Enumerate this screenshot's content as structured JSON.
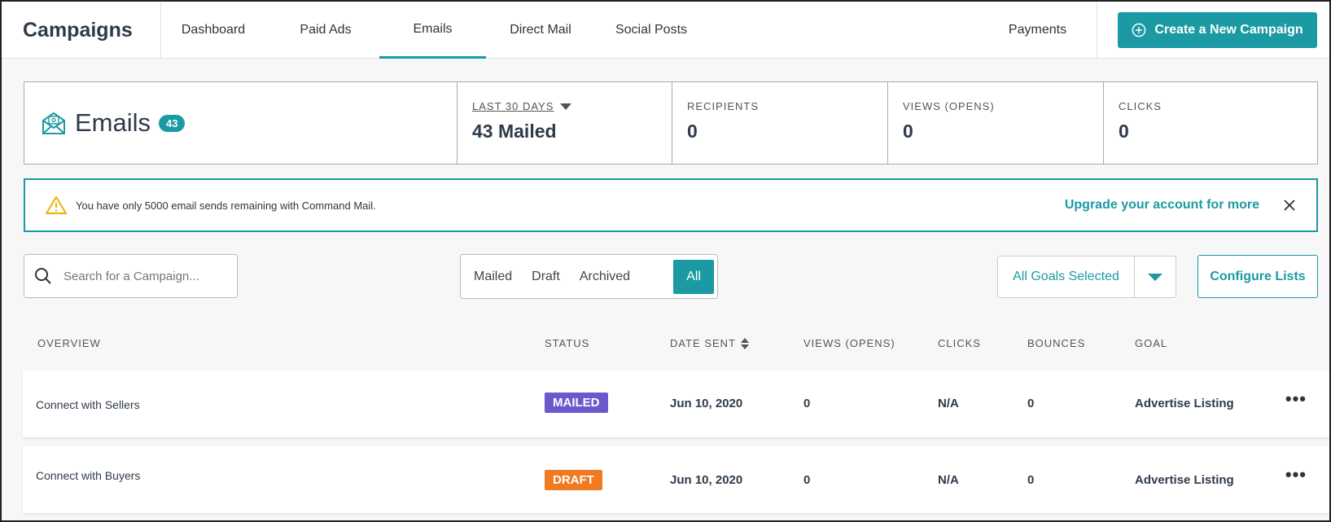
{
  "app": {
    "title": "Campaigns"
  },
  "nav": {
    "tabs": [
      {
        "label": "Dashboard"
      },
      {
        "label": "Paid Ads"
      },
      {
        "label": "Emails"
      },
      {
        "label": "Direct Mail"
      },
      {
        "label": "Social Posts"
      }
    ],
    "active_tab": "Emails",
    "payments": "Payments",
    "create_button": "Create a New Campaign"
  },
  "stats": {
    "title": "Emails",
    "badge": "43",
    "period_label": "LAST 30 DAYS",
    "mailed": "43 Mailed",
    "recipients_label": "RECIPIENTS",
    "recipients_value": "0",
    "views_label": "VIEWS (OPENS)",
    "views_value": "0",
    "clicks_label": "CLICKS",
    "clicks_value": "0"
  },
  "alert": {
    "message": "You have only 5000 email sends remaining with Command Mail.",
    "link": "Upgrade your account for more"
  },
  "filters": {
    "search_placeholder": "Search for a Campaign...",
    "segments": [
      "Mailed",
      "Draft",
      "Archived",
      "All"
    ],
    "active_segment": "All",
    "goals_label": "All Goals Selected",
    "configure_label": "Configure Lists"
  },
  "table": {
    "headers": {
      "overview": "OVERVIEW",
      "status": "STATUS",
      "date_sent": "DATE SENT",
      "views": "VIEWS (OPENS)",
      "clicks": "CLICKS",
      "bounces": "BOUNCES",
      "goal": "GOAL"
    },
    "rows": [
      {
        "overview": "Connect with Sellers",
        "status": "MAILED",
        "status_color": "#6a5acd",
        "date": "Jun 10, 2020",
        "views": "0",
        "clicks": "N/A",
        "bounces": "0",
        "goal": "Advertise Listing"
      },
      {
        "overview": "Connect with Buyers",
        "status": "DRAFT",
        "status_color": "#f07a22",
        "date": "Jun 10, 2020",
        "views": "0",
        "clicks": "N/A",
        "bounces": "0",
        "goal": "Advertise Listing"
      }
    ]
  },
  "colors": {
    "accent": "#1c9aa3",
    "mailed": "#6a5acd",
    "draft": "#f07a22"
  }
}
